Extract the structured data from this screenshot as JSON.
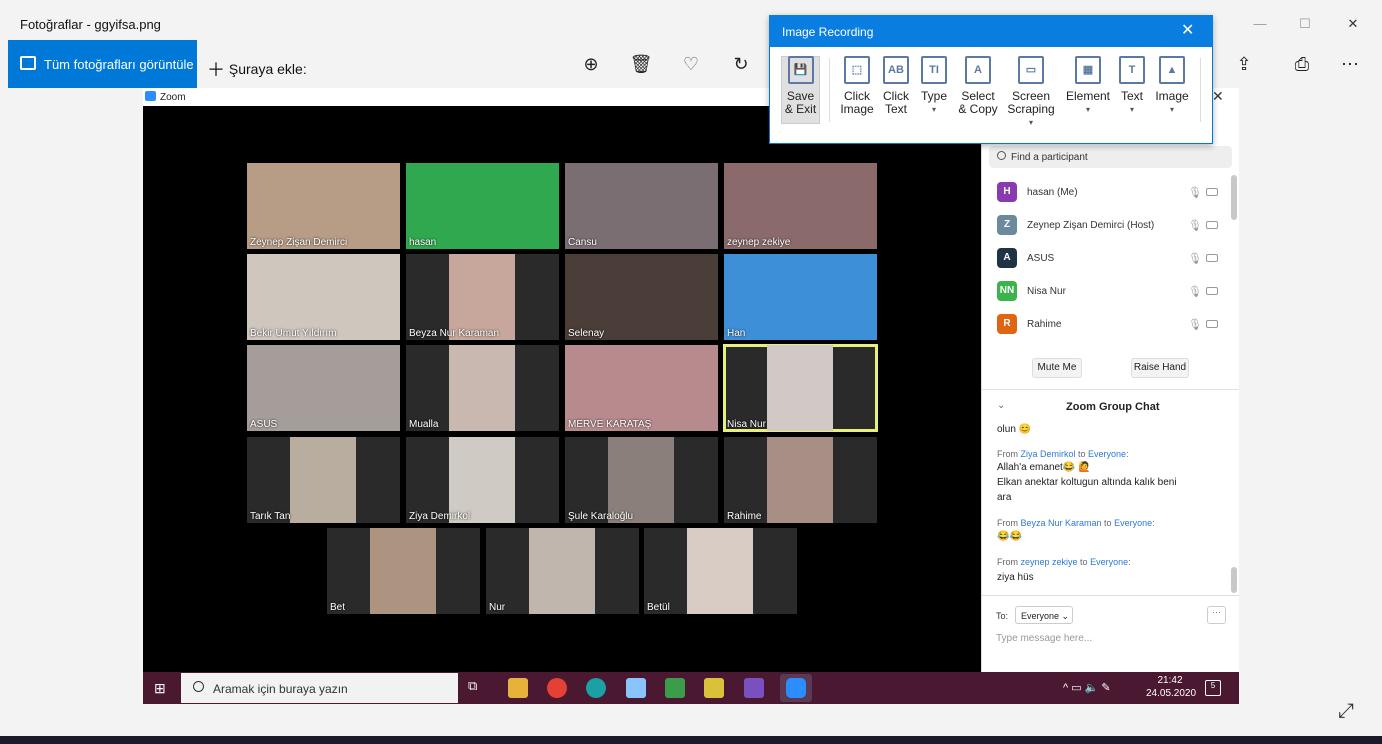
{
  "window": {
    "title": "Fotoğraflar - ggyifsa.png",
    "controls": [
      "—",
      "☐",
      "✕"
    ]
  },
  "toolbar": {
    "view_all": "Tüm fotoğrafları görüntüle",
    "add_to": "Şuraya ekle:"
  },
  "zoom_label": "Zoom",
  "tiles": [
    {
      "name": "Zeynep Zişan Demirci",
      "color": "#b79c86"
    },
    {
      "name": "hasan",
      "color": "#2fa84f"
    },
    {
      "name": "Cansu",
      "color": "#7a6e72"
    },
    {
      "name": "zeynep zekiye",
      "color": "#8a6a6a"
    },
    {
      "name": "Bekir Umut Yıldırım",
      "color": "#cfc6bd"
    },
    {
      "name": "Beyza Nur Karaman",
      "color": "#c7a79c"
    },
    {
      "name": "Selenay",
      "color": "#4b3d38"
    },
    {
      "name": "Han",
      "color": "#3d8fd8"
    },
    {
      "name": "ASUS",
      "color": "#a59d99"
    },
    {
      "name": "Mualla",
      "color": "#c8b8b0"
    },
    {
      "name": "MERVE KARATAŞ",
      "color": "#b78b8e"
    },
    {
      "name": "Nisa Nur",
      "color": "#d2c9c7"
    },
    {
      "name": "Tarık Tan",
      "color": "#b9ada0"
    },
    {
      "name": "Ziya Demirkol",
      "color": "#cfcac3"
    },
    {
      "name": "Şule Karaloğlu",
      "color": "#8a7f7a"
    },
    {
      "name": "Rahime",
      "color": "#a78f86"
    },
    {
      "name": "Bet",
      "color": "#ad9480"
    },
    {
      "name": "Nur",
      "color": "#c1b6ae"
    },
    {
      "name": "Betül",
      "color": "#d9ccc4"
    }
  ],
  "participants": {
    "search_placeholder": "Find a participant",
    "list": [
      {
        "initials": "H",
        "name": "hasan (Me)",
        "color": "#8a3ab0"
      },
      {
        "initials": "Z",
        "name": "Zeynep Zişan Demirci (Host)",
        "color": "#6b8a9e"
      },
      {
        "initials": "A",
        "name": "ASUS",
        "color": "#1f3344"
      },
      {
        "initials": "NN",
        "name": "Nisa Nur",
        "color": "#3cb34c"
      },
      {
        "initials": "R",
        "name": "Rahime",
        "color": "#e06512"
      }
    ],
    "mute_me": "Mute Me",
    "raise_hand": "Raise Hand"
  },
  "chat": {
    "title": "Zoom Group Chat",
    "lines": [
      {
        "type": "text",
        "text": "olun 😊"
      },
      {
        "type": "from",
        "prefix": "From ",
        "who": "Ziya Demirkol",
        "mid": " to ",
        "to": "Everyone",
        "suffix": ":"
      },
      {
        "type": "text",
        "text": "Allah'a emanet😂 🙋"
      },
      {
        "type": "text",
        "text": "Elkan anektar koltugun altında kalık beni"
      },
      {
        "type": "text",
        "text": "ara"
      },
      {
        "type": "from",
        "prefix": "From ",
        "who": "Beyza Nur Karaman",
        "mid": " to ",
        "to": "Everyone",
        "suffix": ":"
      },
      {
        "type": "text",
        "text": "😂😂"
      },
      {
        "type": "from",
        "prefix": "From ",
        "who": "zeynep zekiye",
        "mid": " to ",
        "to": "Everyone",
        "suffix": ":"
      },
      {
        "type": "text",
        "text": "ziya hüs"
      }
    ],
    "to_label": "To:",
    "to_value": "Everyone",
    "more": "···",
    "placeholder": "Type message here..."
  },
  "taskbar": {
    "search": "Aramak için buraya yazın",
    "time": "21:42",
    "date": "24.05.2020",
    "notif_count": "5"
  },
  "image_recording": {
    "title": "Image Recording",
    "buttons": [
      {
        "id": "save",
        "label1": "Save",
        "label2": "& Exit",
        "glyph": "💾"
      },
      {
        "id": "click-image",
        "label1": "Click",
        "label2": "Image",
        "glyph": "⬚"
      },
      {
        "id": "click-text",
        "label1": "Click",
        "label2": "Text",
        "glyph": "AB"
      },
      {
        "id": "type",
        "label1": "Type",
        "label2": "",
        "glyph": "TI"
      },
      {
        "id": "select-copy",
        "label1": "Select",
        "label2": "& Copy",
        "glyph": "A"
      },
      {
        "id": "screen-scraping",
        "label1": "Screen",
        "label2": "Scraping",
        "glyph": "▭"
      },
      {
        "id": "element",
        "label1": "Element",
        "label2": "",
        "glyph": "▦"
      },
      {
        "id": "text",
        "label1": "Text",
        "label2": "",
        "glyph": "T"
      },
      {
        "id": "image",
        "label1": "Image",
        "label2": "",
        "glyph": "▲"
      }
    ]
  }
}
